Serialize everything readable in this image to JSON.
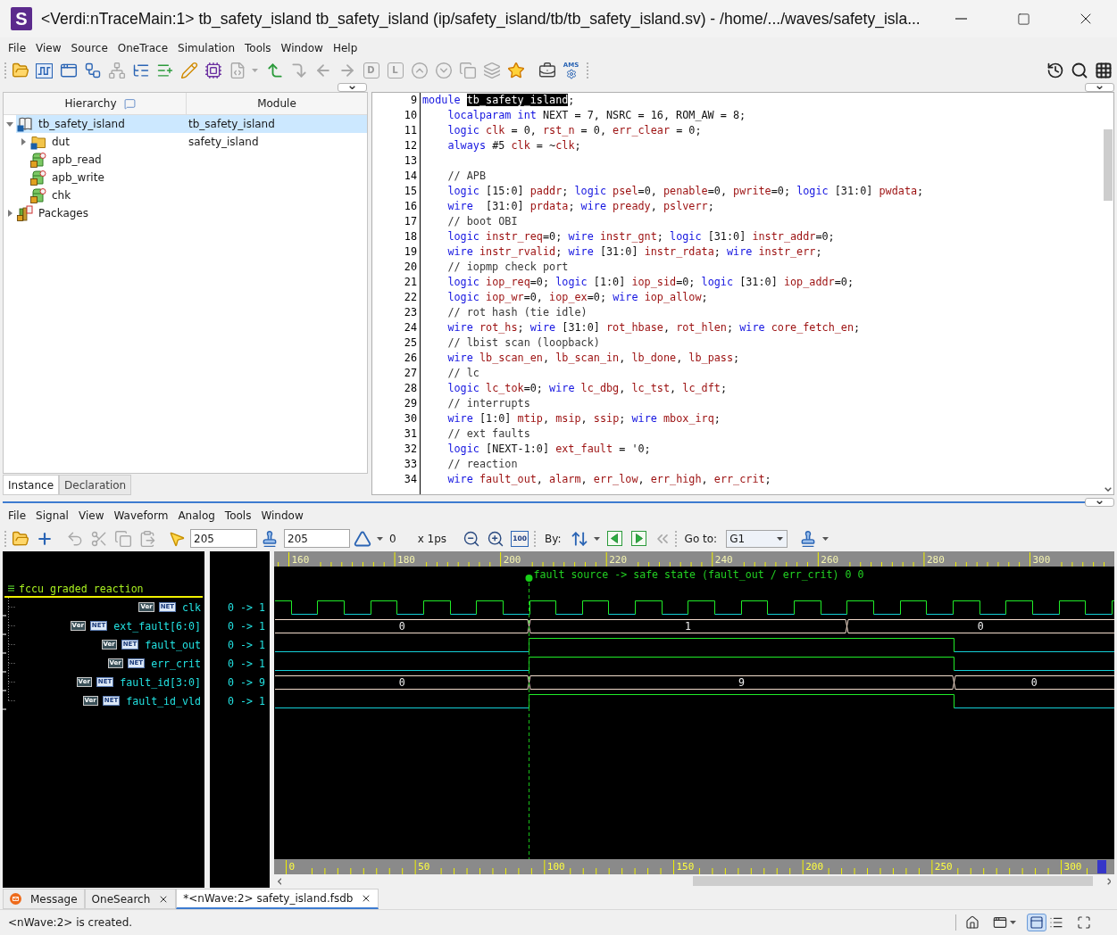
{
  "window": {
    "logo": "S",
    "title": "<Verdi:nTraceMain:1> tb_safety_island tb_safety_island (ip/safety_island/tb/tb_safety_island.sv) - /home/.../waves/safety_isla..."
  },
  "menu": [
    "File",
    "View",
    "Source",
    "OneTrace",
    "Simulation",
    "Tools",
    "Window",
    "Help"
  ],
  "toolbar": {
    "letter_buttons": [
      "D",
      "L"
    ],
    "ams_label": "AMS"
  },
  "hierarchy": {
    "columns": [
      "Hierarchy",
      "Module"
    ],
    "items": [
      {
        "label": "tb_safety_island",
        "module": "tb_safety_island",
        "kind": "instance",
        "selected": true,
        "expanded": true,
        "children": [
          {
            "label": "dut",
            "module": "safety_island",
            "kind": "module",
            "selected": false,
            "expanded": false
          },
          {
            "label": "apb_read",
            "kind": "task",
            "selected": false
          },
          {
            "label": "apb_write",
            "kind": "task",
            "selected": false
          },
          {
            "label": "chk",
            "kind": "task",
            "selected": false
          }
        ]
      },
      {
        "label": "Packages",
        "kind": "package",
        "selected": false,
        "expanded": false
      }
    ],
    "tabs": [
      {
        "label": "Instance",
        "selected": true
      },
      {
        "label": "Declaration",
        "selected": false
      }
    ]
  },
  "source": {
    "lines": [
      {
        "number": "9",
        "tokens": [
          {
            "kind": "keyword",
            "text": "module "
          },
          {
            "kind": "selected",
            "text": "tb_safety_island"
          },
          {
            "kind": "plain",
            "text": ";"
          }
        ],
        "children": [
          {
            "number": "10",
            "tokens": [
              {
                "kind": "keyword",
                "text": "localparam int"
              },
              {
                "kind": "plain",
                "text": " NEXT = 7, NSRC = 16, ROM_AW = 8;"
              }
            ]
          },
          {
            "number": "11",
            "tokens": [
              {
                "kind": "keyword",
                "text": "logic "
              },
              {
                "kind": "name",
                "text": "clk"
              },
              {
                "kind": "plain",
                "text": " = 0, "
              },
              {
                "kind": "name",
                "text": "rst_n"
              },
              {
                "kind": "plain",
                "text": " = 0, "
              },
              {
                "kind": "name",
                "text": "err_clear"
              },
              {
                "kind": "plain",
                "text": " = 0;"
              }
            ]
          },
          {
            "number": "12",
            "tokens": [
              {
                "kind": "keyword",
                "text": "always"
              },
              {
                "kind": "plain",
                "text": " #5 "
              },
              {
                "kind": "name",
                "text": "clk"
              },
              {
                "kind": "plain",
                "text": " = ~"
              },
              {
                "kind": "name",
                "text": "clk"
              },
              {
                "kind": "plain",
                "text": ";"
              }
            ]
          },
          {
            "number": "13"
          },
          {
            "number": "14",
            "tokens": [
              {
                "kind": "comment",
                "text": "// APB"
              }
            ]
          },
          {
            "number": "15",
            "tokens": [
              {
                "kind": "keyword",
                "text": "logic"
              },
              {
                "kind": "plain",
                "text": " [15:0] "
              },
              {
                "kind": "name",
                "text": "paddr"
              },
              {
                "kind": "plain",
                "text": "; "
              },
              {
                "kind": "keyword",
                "text": "logic "
              },
              {
                "kind": "name",
                "text": "psel"
              },
              {
                "kind": "plain",
                "text": "=0, "
              },
              {
                "kind": "name",
                "text": "penable"
              },
              {
                "kind": "plain",
                "text": "=0, "
              },
              {
                "kind": "name",
                "text": "pwrite"
              },
              {
                "kind": "plain",
                "text": "=0; "
              },
              {
                "kind": "keyword",
                "text": "logic"
              },
              {
                "kind": "plain",
                "text": " [31:0] "
              },
              {
                "kind": "name",
                "text": "pwdata"
              },
              {
                "kind": "plain",
                "text": ";"
              }
            ]
          },
          {
            "number": "16",
            "tokens": [
              {
                "kind": "keyword",
                "text": "wire"
              },
              {
                "kind": "plain",
                "text": "  [31:0] "
              },
              {
                "kind": "name",
                "text": "prdata"
              },
              {
                "kind": "plain",
                "text": "; "
              },
              {
                "kind": "keyword",
                "text": "wire "
              },
              {
                "kind": "name",
                "text": "pready"
              },
              {
                "kind": "plain",
                "text": ", "
              },
              {
                "kind": "name",
                "text": "pslverr"
              },
              {
                "kind": "plain",
                "text": ";"
              }
            ]
          },
          {
            "number": "17",
            "tokens": [
              {
                "kind": "comment",
                "text": "// boot OBI"
              }
            ]
          },
          {
            "number": "18",
            "tokens": [
              {
                "kind": "keyword",
                "text": "logic "
              },
              {
                "kind": "name",
                "text": "instr_req"
              },
              {
                "kind": "plain",
                "text": "=0; "
              },
              {
                "kind": "keyword",
                "text": "wire "
              },
              {
                "kind": "name",
                "text": "instr_gnt"
              },
              {
                "kind": "plain",
                "text": "; "
              },
              {
                "kind": "keyword",
                "text": "logic"
              },
              {
                "kind": "plain",
                "text": " [31:0] "
              },
              {
                "kind": "name",
                "text": "instr_addr"
              },
              {
                "kind": "plain",
                "text": "=0;"
              }
            ]
          },
          {
            "number": "19",
            "tokens": [
              {
                "kind": "keyword",
                "text": "wire "
              },
              {
                "kind": "name",
                "text": "instr_rvalid"
              },
              {
                "kind": "plain",
                "text": "; "
              },
              {
                "kind": "keyword",
                "text": "wire"
              },
              {
                "kind": "plain",
                "text": " [31:0] "
              },
              {
                "kind": "name",
                "text": "instr_rdata"
              },
              {
                "kind": "plain",
                "text": "; "
              },
              {
                "kind": "keyword",
                "text": "wire "
              },
              {
                "kind": "name",
                "text": "instr_err"
              },
              {
                "kind": "plain",
                "text": ";"
              }
            ]
          },
          {
            "number": "20",
            "tokens": [
              {
                "kind": "comment",
                "text": "// iopmp check port"
              }
            ]
          },
          {
            "number": "21",
            "tokens": [
              {
                "kind": "keyword",
                "text": "logic "
              },
              {
                "kind": "name",
                "text": "iop_req"
              },
              {
                "kind": "plain",
                "text": "=0; "
              },
              {
                "kind": "keyword",
                "text": "logic"
              },
              {
                "kind": "plain",
                "text": " [1:0] "
              },
              {
                "kind": "name",
                "text": "iop_sid"
              },
              {
                "kind": "plain",
                "text": "=0; "
              },
              {
                "kind": "keyword",
                "text": "logic"
              },
              {
                "kind": "plain",
                "text": " [31:0] "
              },
              {
                "kind": "name",
                "text": "iop_addr"
              },
              {
                "kind": "plain",
                "text": "=0;"
              }
            ]
          },
          {
            "number": "22",
            "tokens": [
              {
                "kind": "keyword",
                "text": "logic "
              },
              {
                "kind": "name",
                "text": "iop_wr"
              },
              {
                "kind": "plain",
                "text": "=0, "
              },
              {
                "kind": "name",
                "text": "iop_ex"
              },
              {
                "kind": "plain",
                "text": "=0; "
              },
              {
                "kind": "keyword",
                "text": "wire "
              },
              {
                "kind": "name",
                "text": "iop_allow"
              },
              {
                "kind": "plain",
                "text": ";"
              }
            ]
          },
          {
            "number": "23",
            "tokens": [
              {
                "kind": "comment",
                "text": "// rot hash (tie idle)"
              }
            ]
          },
          {
            "number": "24",
            "tokens": [
              {
                "kind": "keyword",
                "text": "wire "
              },
              {
                "kind": "name",
                "text": "rot_hs"
              },
              {
                "kind": "plain",
                "text": "; "
              },
              {
                "kind": "keyword",
                "text": "wire"
              },
              {
                "kind": "plain",
                "text": " [31:0] "
              },
              {
                "kind": "name",
                "text": "rot_hbase"
              },
              {
                "kind": "plain",
                "text": ", "
              },
              {
                "kind": "name",
                "text": "rot_hlen"
              },
              {
                "kind": "plain",
                "text": "; "
              },
              {
                "kind": "keyword",
                "text": "wire "
              },
              {
                "kind": "name",
                "text": "core_fetch_en"
              },
              {
                "kind": "plain",
                "text": ";"
              }
            ]
          },
          {
            "number": "25",
            "tokens": [
              {
                "kind": "comment",
                "text": "// lbist scan (loopback)"
              }
            ]
          },
          {
            "number": "26",
            "tokens": [
              {
                "kind": "keyword",
                "text": "wire "
              },
              {
                "kind": "name",
                "text": "lb_scan_en"
              },
              {
                "kind": "plain",
                "text": ", "
              },
              {
                "kind": "name",
                "text": "lb_scan_in"
              },
              {
                "kind": "plain",
                "text": ", "
              },
              {
                "kind": "name",
                "text": "lb_done"
              },
              {
                "kind": "plain",
                "text": ", "
              },
              {
                "kind": "name",
                "text": "lb_pass"
              },
              {
                "kind": "plain",
                "text": ";"
              }
            ]
          },
          {
            "number": "27",
            "tokens": [
              {
                "kind": "comment",
                "text": "// lc"
              }
            ]
          },
          {
            "number": "28",
            "tokens": [
              {
                "kind": "keyword",
                "text": "logic "
              },
              {
                "kind": "name",
                "text": "lc_tok"
              },
              {
                "kind": "plain",
                "text": "=0; "
              },
              {
                "kind": "keyword",
                "text": "wire "
              },
              {
                "kind": "name",
                "text": "lc_dbg"
              },
              {
                "kind": "plain",
                "text": ", "
              },
              {
                "kind": "name",
                "text": "lc_tst"
              },
              {
                "kind": "plain",
                "text": ", "
              },
              {
                "kind": "name",
                "text": "lc_dft"
              },
              {
                "kind": "plain",
                "text": ";"
              }
            ]
          },
          {
            "number": "29",
            "tokens": [
              {
                "kind": "comment",
                "text": "// interrupts"
              }
            ]
          },
          {
            "number": "30",
            "tokens": [
              {
                "kind": "keyword",
                "text": "wire"
              },
              {
                "kind": "plain",
                "text": " [1:0] "
              },
              {
                "kind": "name",
                "text": "mtip"
              },
              {
                "kind": "plain",
                "text": ", "
              },
              {
                "kind": "name",
                "text": "msip"
              },
              {
                "kind": "plain",
                "text": ", "
              },
              {
                "kind": "name",
                "text": "ssip"
              },
              {
                "kind": "plain",
                "text": "; "
              },
              {
                "kind": "keyword",
                "text": "wire "
              },
              {
                "kind": "name",
                "text": "mbox_irq"
              },
              {
                "kind": "plain",
                "text": ";"
              }
            ]
          },
          {
            "number": "31",
            "tokens": [
              {
                "kind": "comment",
                "text": "// ext faults"
              }
            ]
          },
          {
            "number": "32",
            "tokens": [
              {
                "kind": "keyword",
                "text": "logic"
              },
              {
                "kind": "plain",
                "text": " [NEXT-1:0] "
              },
              {
                "kind": "name",
                "text": "ext_fault"
              },
              {
                "kind": "plain",
                "text": " = '0;"
              }
            ]
          },
          {
            "number": "33",
            "tokens": [
              {
                "kind": "comment",
                "text": "// reaction"
              }
            ]
          },
          {
            "number": "34",
            "tokens": [
              {
                "kind": "keyword",
                "text": "wire "
              },
              {
                "kind": "name",
                "text": "fault_out"
              },
              {
                "kind": "plain",
                "text": ", "
              },
              {
                "kind": "name",
                "text": "alarm"
              },
              {
                "kind": "plain",
                "text": ", "
              },
              {
                "kind": "name",
                "text": "err_low"
              },
              {
                "kind": "plain",
                "text": ", "
              },
              {
                "kind": "name",
                "text": "err_high"
              },
              {
                "kind": "plain",
                "text": ", "
              },
              {
                "kind": "name",
                "text": "err_crit"
              },
              {
                "kind": "plain",
                "text": ";"
              }
            ]
          }
        ]
      }
    ]
  },
  "wave_menu": [
    "File",
    "Signal",
    "View",
    "Waveform",
    "Analog",
    "Tools",
    "Window"
  ],
  "wave_toolbar": {
    "cursor": {
      "value": "205"
    },
    "marker": {
      "value": "205"
    },
    "delta": "0",
    "unit": "x 1ps",
    "zoom_fit": "100",
    "by_label": "By:",
    "goto_label": "Go to:",
    "goto_value": "G1"
  },
  "waveform": {
    "group": "fccu graded reaction",
    "marker_label": "fault source -> safe state (fault_out / err_crit) 0 0",
    "ruler_labels": [
      "160",
      "180",
      "200",
      "220",
      "240",
      "260",
      "280",
      "300"
    ],
    "overview_labels": [
      "0",
      "50",
      "100",
      "150",
      "200",
      "250",
      "300"
    ],
    "signals": [
      {
        "name": "clk",
        "kind": "clock",
        "tags": [
          "Ver",
          "NET"
        ],
        "value": "0 -> 1"
      },
      {
        "name": "ext_fault[6:0]",
        "kind": "bus",
        "tags": [
          "Ver",
          "NET"
        ],
        "value": "0 -> 1",
        "segments": [
          "0",
          "1",
          "0"
        ]
      },
      {
        "name": "fault_out",
        "kind": "bit",
        "tags": [
          "Ver",
          "NET"
        ],
        "value": "0 -> 1"
      },
      {
        "name": "err_crit",
        "kind": "bit",
        "tags": [
          "Ver",
          "NET"
        ],
        "value": "0 -> 1"
      },
      {
        "name": "fault_id[3:0]",
        "kind": "bus",
        "tags": [
          "Ver",
          "NET"
        ],
        "value": "0 -> 9",
        "segments": [
          "0",
          "9",
          "0"
        ]
      },
      {
        "name": "fault_id_vld",
        "kind": "bit",
        "tags": [
          "Ver",
          "NET"
        ],
        "value": "0 -> 1"
      }
    ]
  },
  "bottom_tabs": [
    {
      "label": "Message",
      "selected": false,
      "closable": false
    },
    {
      "label": "OneSearch",
      "selected": false,
      "closable": true
    },
    {
      "label": "*<nWave:2> safety_island.fsdb",
      "selected": true,
      "closable": true
    }
  ],
  "status_bar": {
    "message": "<nWave:2> is created.",
    "view_toggles": [
      {
        "selected": true
      },
      {
        "selected": false
      }
    ]
  }
}
